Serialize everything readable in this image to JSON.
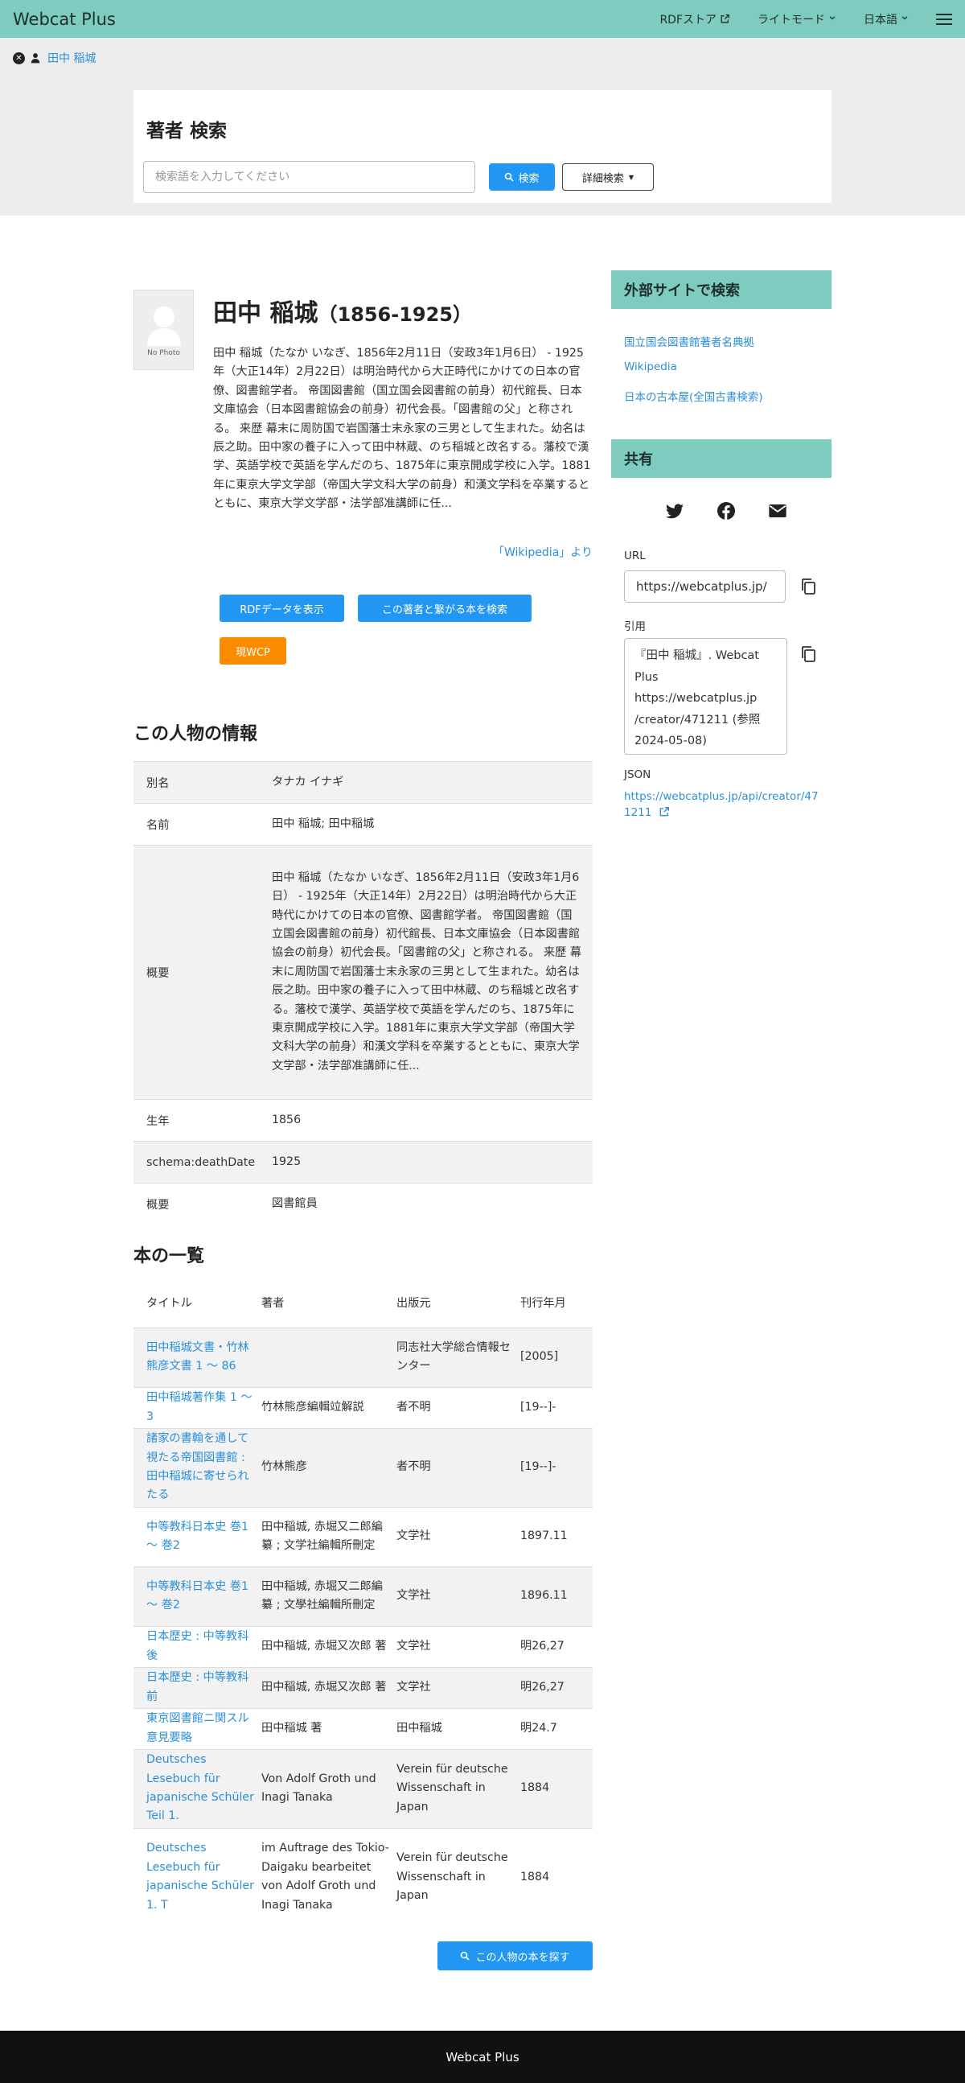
{
  "navbar": {
    "brand": "Webcat Plus",
    "rdf_store": "RDFストア",
    "light_mode": "ライトモード",
    "language": "日本語"
  },
  "breadcrumb": {
    "label": "田中 稲城"
  },
  "search": {
    "title": "著者 検索",
    "placeholder": "検索語を入力してください",
    "search_button": "検索",
    "detail_button": "詳細検索"
  },
  "person": {
    "no_photo": "No Photo",
    "name": "田中 稲城",
    "years": "（1856-1925）",
    "bio": "田中 稲城（たなか いなぎ、1856年2月11日（安政3年1月6日） - 1925年（大正14年）2月22日）は明治時代から大正時代にかけての日本の官僚、図書館学者。 帝国図書館（国立国会図書館の前身）初代館長、日本文庫協会（日本図書館協会の前身）初代会長。「図書館の父」と称される。 来歴 幕末に周防国で岩国藩士末永家の三男として生まれた。幼名は辰之助。田中家の養子に入って田中林蔵、のち稲城と改名する。藩校で漢学、英語学校で英語を学んだのち、1875年に東京開成学校に入学。1881年に東京大学文学部（帝国大学文科大学の前身）和漢文学科を卒業するとともに、東京大学文学部・法学部准講師に任...",
    "source": "「Wikipedia」より",
    "rdf_button": "RDFデータを表示",
    "related_button": "この著者と繋がる本を検索",
    "wcp_button": "現WCP"
  },
  "info": {
    "title": "この人物の情報",
    "rows": [
      {
        "key": "別名",
        "value": "タナカ イナギ"
      },
      {
        "key": "名前",
        "value": "田中 稲城; 田中稲城"
      },
      {
        "key": "概要",
        "value": "田中 稲城（たなか いなぎ、1856年2月11日（安政3年1月6日） - 1925年（大正14年）2月22日）は明治時代から大正時代にかけての日本の官僚、図書館学者。 帝国図書館（国立国会図書館の前身）初代館長、日本文庫協会（日本図書館協会の前身）初代会長。「図書館の父」と称される。 来歴 幕末に周防国で岩国藩士末永家の三男として生まれた。幼名は辰之助。田中家の養子に入って田中林蔵、のち稲城と改名する。藩校で漢学、英語学校で英語を学んだのち、1875年に東京開成学校に入学。1881年に東京大学文学部（帝国大学文科大学の前身）和漢文学科を卒業するとともに、東京大学文学部・法学部准講師に任..."
      },
      {
        "key": "生年",
        "value": "1856"
      },
      {
        "key": "schema:deathDate",
        "value": "1925"
      },
      {
        "key": "概要",
        "value": "図書館員"
      }
    ]
  },
  "books": {
    "title": "本の一覧",
    "headers": [
      "タイトル",
      "著者",
      "出版元",
      "刊行年月"
    ],
    "rows": [
      {
        "title": "田中稲城文書・竹林熊彦文書 1 〜 86",
        "author": "",
        "publisher": "同志社大学総合情報センター",
        "date": "[2005]"
      },
      {
        "title": "田中稲城著作集 1 〜 3",
        "author": "竹林熊彦編輯竝解説",
        "publisher": "者不明",
        "date": "[19--]-"
      },
      {
        "title": "諸家の書翰を通して視たる帝国図書館 : 田中稲城に寄せられたる",
        "author": "竹林熊彦",
        "publisher": "者不明",
        "date": "[19--]-"
      },
      {
        "title": "中等教科日本史 巻1 〜 巻2",
        "author": "田中稲城, 赤堀又二郎編纂 ; 文学社編輯所刪定",
        "publisher": "文学社",
        "date": "1897.11"
      },
      {
        "title": "中等教科日本史 巻1 〜 巻2",
        "author": "田中稲城, 赤堀又二郎編纂 ; 文學社編輯所刪定",
        "publisher": "文学社",
        "date": "1896.11"
      },
      {
        "title": "日本歴史 : 中等教科 後",
        "author": "田中稲城, 赤堀又次郎 著",
        "publisher": "文学社",
        "date": "明26,27"
      },
      {
        "title": "日本歴史 : 中等教科 前",
        "author": "田中稲城, 赤堀又次郎 著",
        "publisher": "文学社",
        "date": "明26,27"
      },
      {
        "title": "東京図書館ニ関スル意見要略",
        "author": "田中稲城 著",
        "publisher": "田中稲城",
        "date": "明24.7"
      },
      {
        "title": "Deutsches Lesebuch für japanische Schüler Teil 1.",
        "author": "Von Adolf Groth und Inagi Tanaka",
        "publisher": "Verein für deutsche Wissenschaft in Japan",
        "date": "1884"
      },
      {
        "title": "Deutsches Lesebuch für japanische Schüler 1. T",
        "author": "im Auftrage des Tokio-Daigaku bearbeitet von Adolf Groth und Inagi Tanaka",
        "publisher": "Verein für deutsche Wissenschaft in Japan",
        "date": "1884"
      }
    ],
    "more_button": "この人物の本を探す"
  },
  "sidebar": {
    "external_title": "外部サイトで検索",
    "external_links": [
      "国立国会図書館著者名典拠",
      "Wikipedia",
      "日本の古本屋(全国古書検索)"
    ],
    "share_title": "共有",
    "url_label": "URL",
    "url_value": "https://webcatplus.jp/",
    "cite_label": "引用",
    "cite_value": "『田中 稲城』. Webcat Plus\nhttps://webcatplus.jp\n/creator/471211 (参照\n2024-05-08)",
    "json_label": "JSON",
    "json_url": "https://webcatplus.jp/api/creator/471211"
  },
  "footer": {
    "text": "Webcat Plus"
  },
  "colors": {
    "header": "#7ecbc0",
    "primary": "#2196f3",
    "accent": "#fb8c00",
    "link": "#2a8fd8"
  }
}
